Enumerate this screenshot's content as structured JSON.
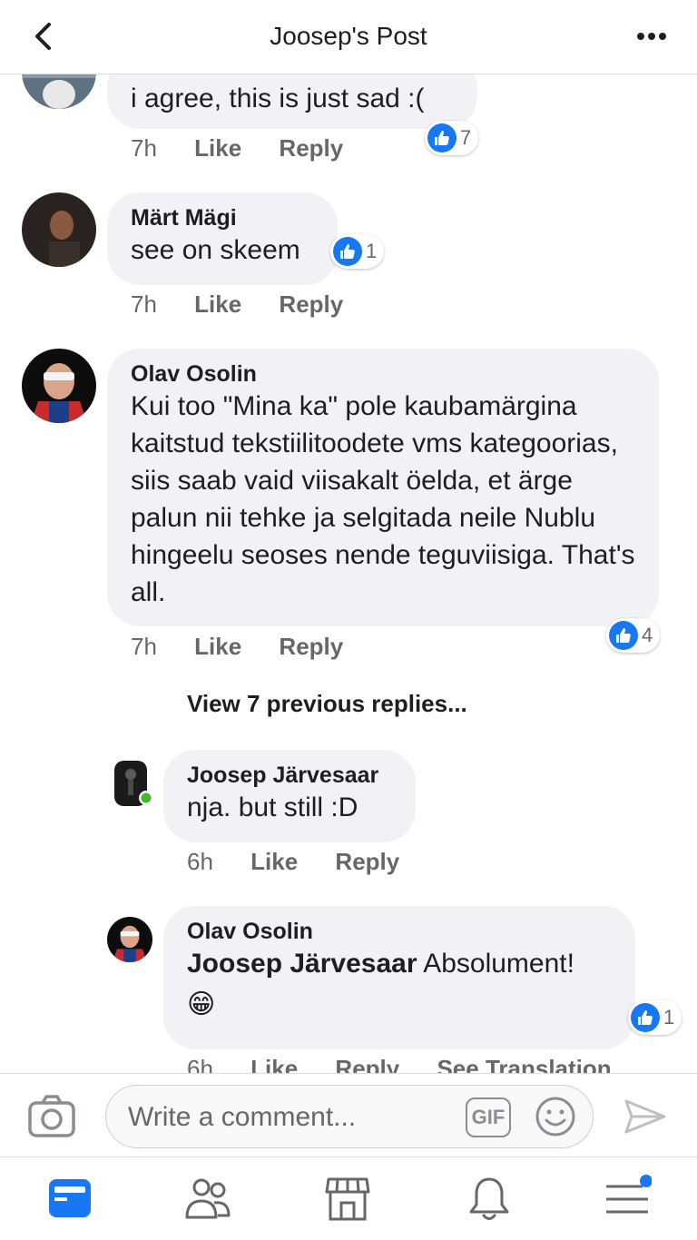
{
  "header": {
    "title": "Joosep's Post"
  },
  "comments": [
    {
      "name": "",
      "text": "i agree, this is just sad :(",
      "time": "7h",
      "like": "Like",
      "reply": "Reply",
      "reactions": "7"
    },
    {
      "name": "Märt Mägi",
      "text": "see on skeem",
      "time": "7h",
      "like": "Like",
      "reply": "Reply",
      "reactions": "1"
    },
    {
      "name": "Olav Osolin",
      "text": "Kui too \"Mina ka\" pole kaubamärgina kaitstud tekstiilitoodete vms kategoorias, siis saab vaid viisakalt öelda, et ärge palun nii tehke ja selgitada neile Nublu hingeelu seoses nende teguviisiga. That's all.",
      "time": "7h",
      "like": "Like",
      "reply": "Reply",
      "reactions": "4"
    }
  ],
  "view_previous": "View 7 previous replies...",
  "replies": [
    {
      "name": "Joosep Järvesaar",
      "text": "nja. but still :D",
      "time": "6h",
      "like": "Like",
      "reply": "Reply"
    },
    {
      "name": "Olav Osolin",
      "mention": "Joosep Järvesaar",
      "text": "Absolument!",
      "emoji": "😁",
      "time": "6h",
      "like": "Like",
      "reply": "Reply",
      "translate": "See Translation",
      "reactions": "1"
    }
  ],
  "composer": {
    "placeholder": "Write a comment...",
    "gif_label": "GIF"
  },
  "nav": {
    "items": [
      {
        "icon": "news-feed-icon",
        "active": true
      },
      {
        "icon": "friends-icon",
        "active": false
      },
      {
        "icon": "marketplace-icon",
        "active": false
      },
      {
        "icon": "notifications-icon",
        "active": false
      },
      {
        "icon": "menu-icon",
        "active": false,
        "badge": true
      }
    ]
  },
  "colors": {
    "accent": "#1877f2",
    "bubble": "#f0f2f5",
    "meta": "#65676b",
    "online": "#42b72a"
  }
}
